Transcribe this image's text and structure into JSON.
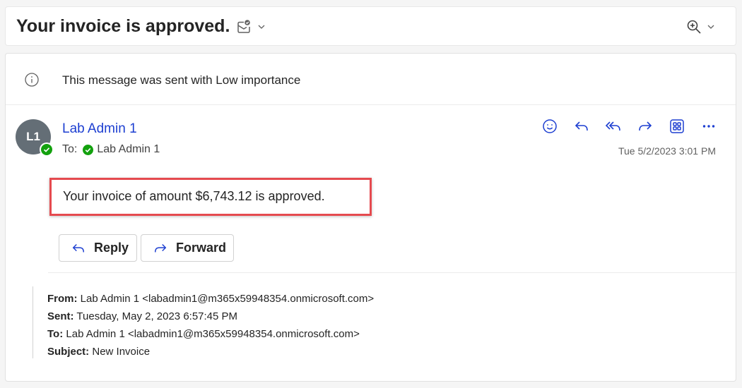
{
  "subject": {
    "title": "Your invoice is approved.",
    "icons": [
      "mail-check-icon",
      "chevron-down-icon",
      "zoom-in-icon",
      "chevron-down-icon"
    ]
  },
  "importance": {
    "icon": "info-icon",
    "text": "This message was sent with Low importance"
  },
  "message": {
    "avatar_initials": "L1",
    "sender": "Lab Admin 1",
    "to_label": "To:",
    "to_name": "Lab Admin 1",
    "timestamp": "Tue 5/2/2023 3:01 PM",
    "body": "Your invoice of amount $6,743.12 is approved.",
    "actions": [
      "emoji-icon",
      "reply-icon",
      "reply-all-icon",
      "forward-icon",
      "apps-icon",
      "more-icon"
    ]
  },
  "buttons": {
    "reply": "Reply",
    "forward": "Forward"
  },
  "quoted": {
    "from_label": "From:",
    "from_value": "Lab Admin 1 <labadmin1@m365x59948354.onmicrosoft.com>",
    "sent_label": "Sent:",
    "sent_value": "Tuesday, May 2, 2023 6:57:45 PM",
    "to_label": "To:",
    "to_value": "Lab Admin 1 <labadmin1@m365x59948354.onmicrosoft.com>",
    "subject_label": "Subject:",
    "subject_value": "New Invoice"
  },
  "colors": {
    "accent": "#1d3fd1",
    "presence": "#13a10e",
    "highlight_border": "#e54a4f",
    "avatar_bg": "#646e76"
  }
}
